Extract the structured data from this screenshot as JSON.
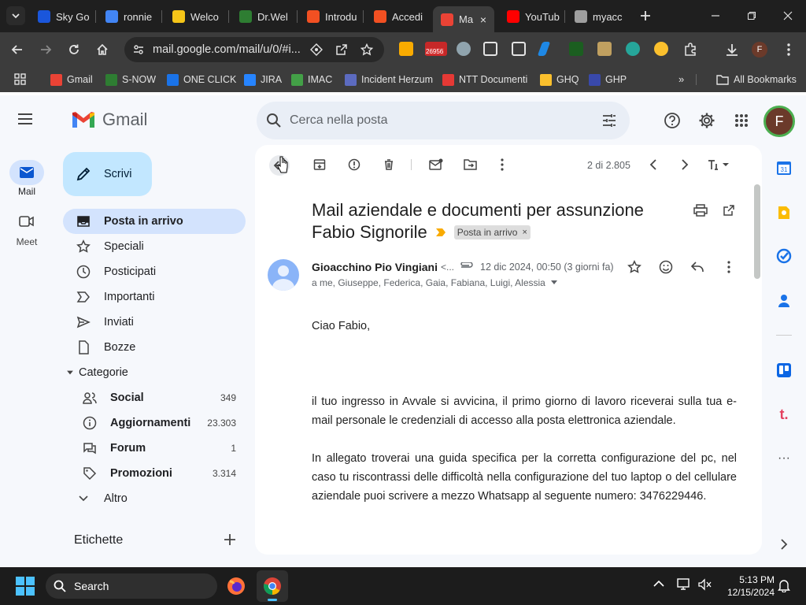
{
  "browser": {
    "tabs": [
      {
        "label": "Sky Go",
        "color": "#1a56db"
      },
      {
        "label": "ronnie",
        "color": "#4285f4"
      },
      {
        "label": "Welco",
        "color": "#f5c518"
      },
      {
        "label": "Dr.Wel",
        "color": "#2e7d32"
      },
      {
        "label": "Introdu",
        "color": "#f25022"
      },
      {
        "label": "Accedi",
        "color": "#f25022"
      },
      {
        "label": "Ma",
        "color": "#ea4335"
      },
      {
        "label": "YouTub",
        "color": "#ff0000"
      },
      {
        "label": "myacc",
        "color": "#9e9e9e"
      }
    ],
    "url": "mail.google.com/mail/u/0/#i...",
    "extension_badge": "26956",
    "bookmarks": [
      {
        "label": "Gmail",
        "color": "#ea4335"
      },
      {
        "label": "S-NOW",
        "color": "#2e7d32"
      },
      {
        "label": "ONE CLICK",
        "color": "#1a73e8"
      },
      {
        "label": "JIRA",
        "color": "#2684ff"
      },
      {
        "label": "IMAC",
        "color": "#43a047"
      },
      {
        "label": "Incident Herzum",
        "color": "#5c6bc0"
      },
      {
        "label": "NTT Documenti",
        "color": "#e53935"
      },
      {
        "label": "GHQ",
        "color": "#fbc02d"
      },
      {
        "label": "GHP",
        "color": "#3949ab"
      }
    ],
    "all_bookmarks": "All Bookmarks",
    "profile_initial": "F"
  },
  "gmail": {
    "logo": "Gmail",
    "search_placeholder": "Cerca nella posta",
    "compose": "Scrivi",
    "rail": {
      "mail": "Mail",
      "meet": "Meet"
    },
    "nav": [
      {
        "label": "Posta in arrivo",
        "icon": "inbox-icon"
      },
      {
        "label": "Speciali",
        "icon": "star-icon"
      },
      {
        "label": "Posticipati",
        "icon": "clock-icon"
      },
      {
        "label": "Importanti",
        "icon": "important-icon"
      },
      {
        "label": "Inviati",
        "icon": "send-icon"
      },
      {
        "label": "Bozze",
        "icon": "draft-icon"
      },
      {
        "label": "Categorie",
        "icon": "caret-icon"
      }
    ],
    "categories": [
      {
        "label": "Social",
        "count": "349"
      },
      {
        "label": "Aggiornamenti",
        "count": "23.303"
      },
      {
        "label": "Forum",
        "count": "1"
      },
      {
        "label": "Promozioni",
        "count": "3.314"
      }
    ],
    "more": "Altro",
    "labels_heading": "Etichette",
    "avatar_initial": "F",
    "pager": "2 di 2.805",
    "message": {
      "subject_line1": "Mail aziendale e documenti per assunzione",
      "subject_line2": "Fabio Signorile",
      "label_chip": "Posta in arrivo",
      "sender": "Gioacchino Pio Vingiani",
      "sender_suffix": "<...",
      "date": "12 dic 2024, 00:50 (3 giorni fa)",
      "recipients": "a me, Giuseppe, Federica, Gaia, Fabiana, Luigi, Alessia",
      "greeting": "Ciao Fabio,",
      "paragraph1": "il tuo ingresso in Avvale si avvicina, il primo giorno di lavoro riceverai sulla tua e-mail personale le credenziali di accesso alla posta elettronica aziendale.",
      "paragraph2": "In allegato troverai una guida specifica per la corretta configurazione del pc, nel caso tu riscontrassi delle difficoltà nella configurazione del tuo laptop o del cellulare aziendale puoi scrivere a mezzo Whatsapp al seguente numero: 3476229446."
    }
  },
  "taskbar": {
    "search": "Search",
    "time": "5:13 PM",
    "date": "12/15/2024"
  }
}
